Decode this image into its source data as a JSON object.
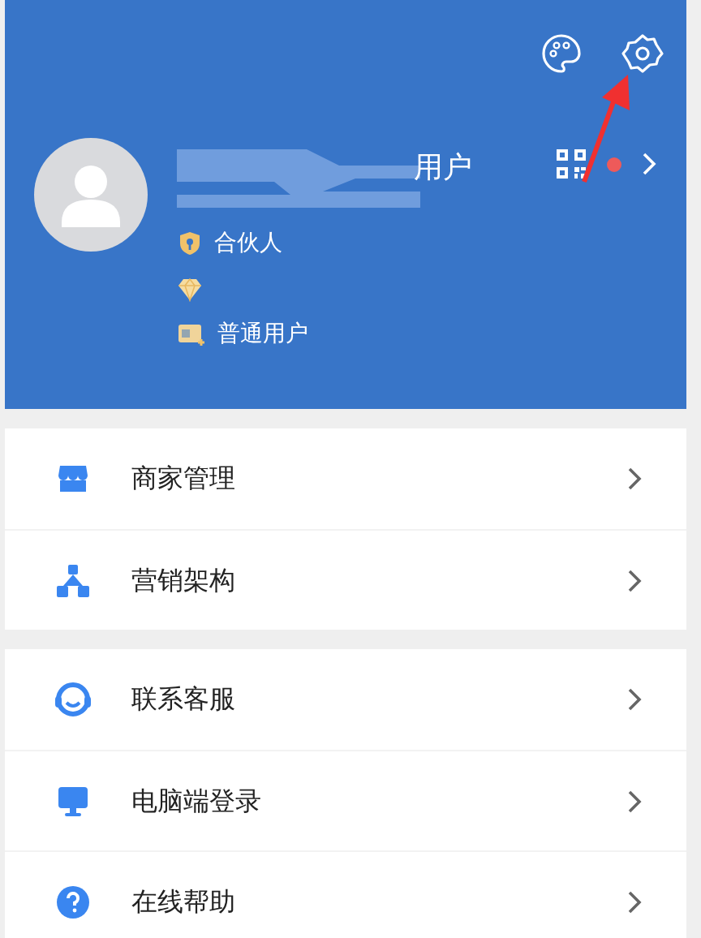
{
  "profile": {
    "name": "用户",
    "badges": [
      {
        "kind": "partner",
        "label": "合伙人"
      },
      {
        "kind": "diamond"
      },
      {
        "kind": "card",
        "label": "普通用户"
      }
    ],
    "notification_dot": true
  },
  "menu_groups": [
    {
      "items": [
        {
          "kind": "shop",
          "label": "商家管理"
        },
        {
          "kind": "network",
          "label": "营销架构"
        }
      ]
    },
    {
      "items": [
        {
          "kind": "service",
          "label": "联系客服"
        },
        {
          "kind": "desktop",
          "label": "电脑端登录"
        },
        {
          "kind": "help",
          "label": "在线帮助"
        }
      ]
    }
  ]
}
